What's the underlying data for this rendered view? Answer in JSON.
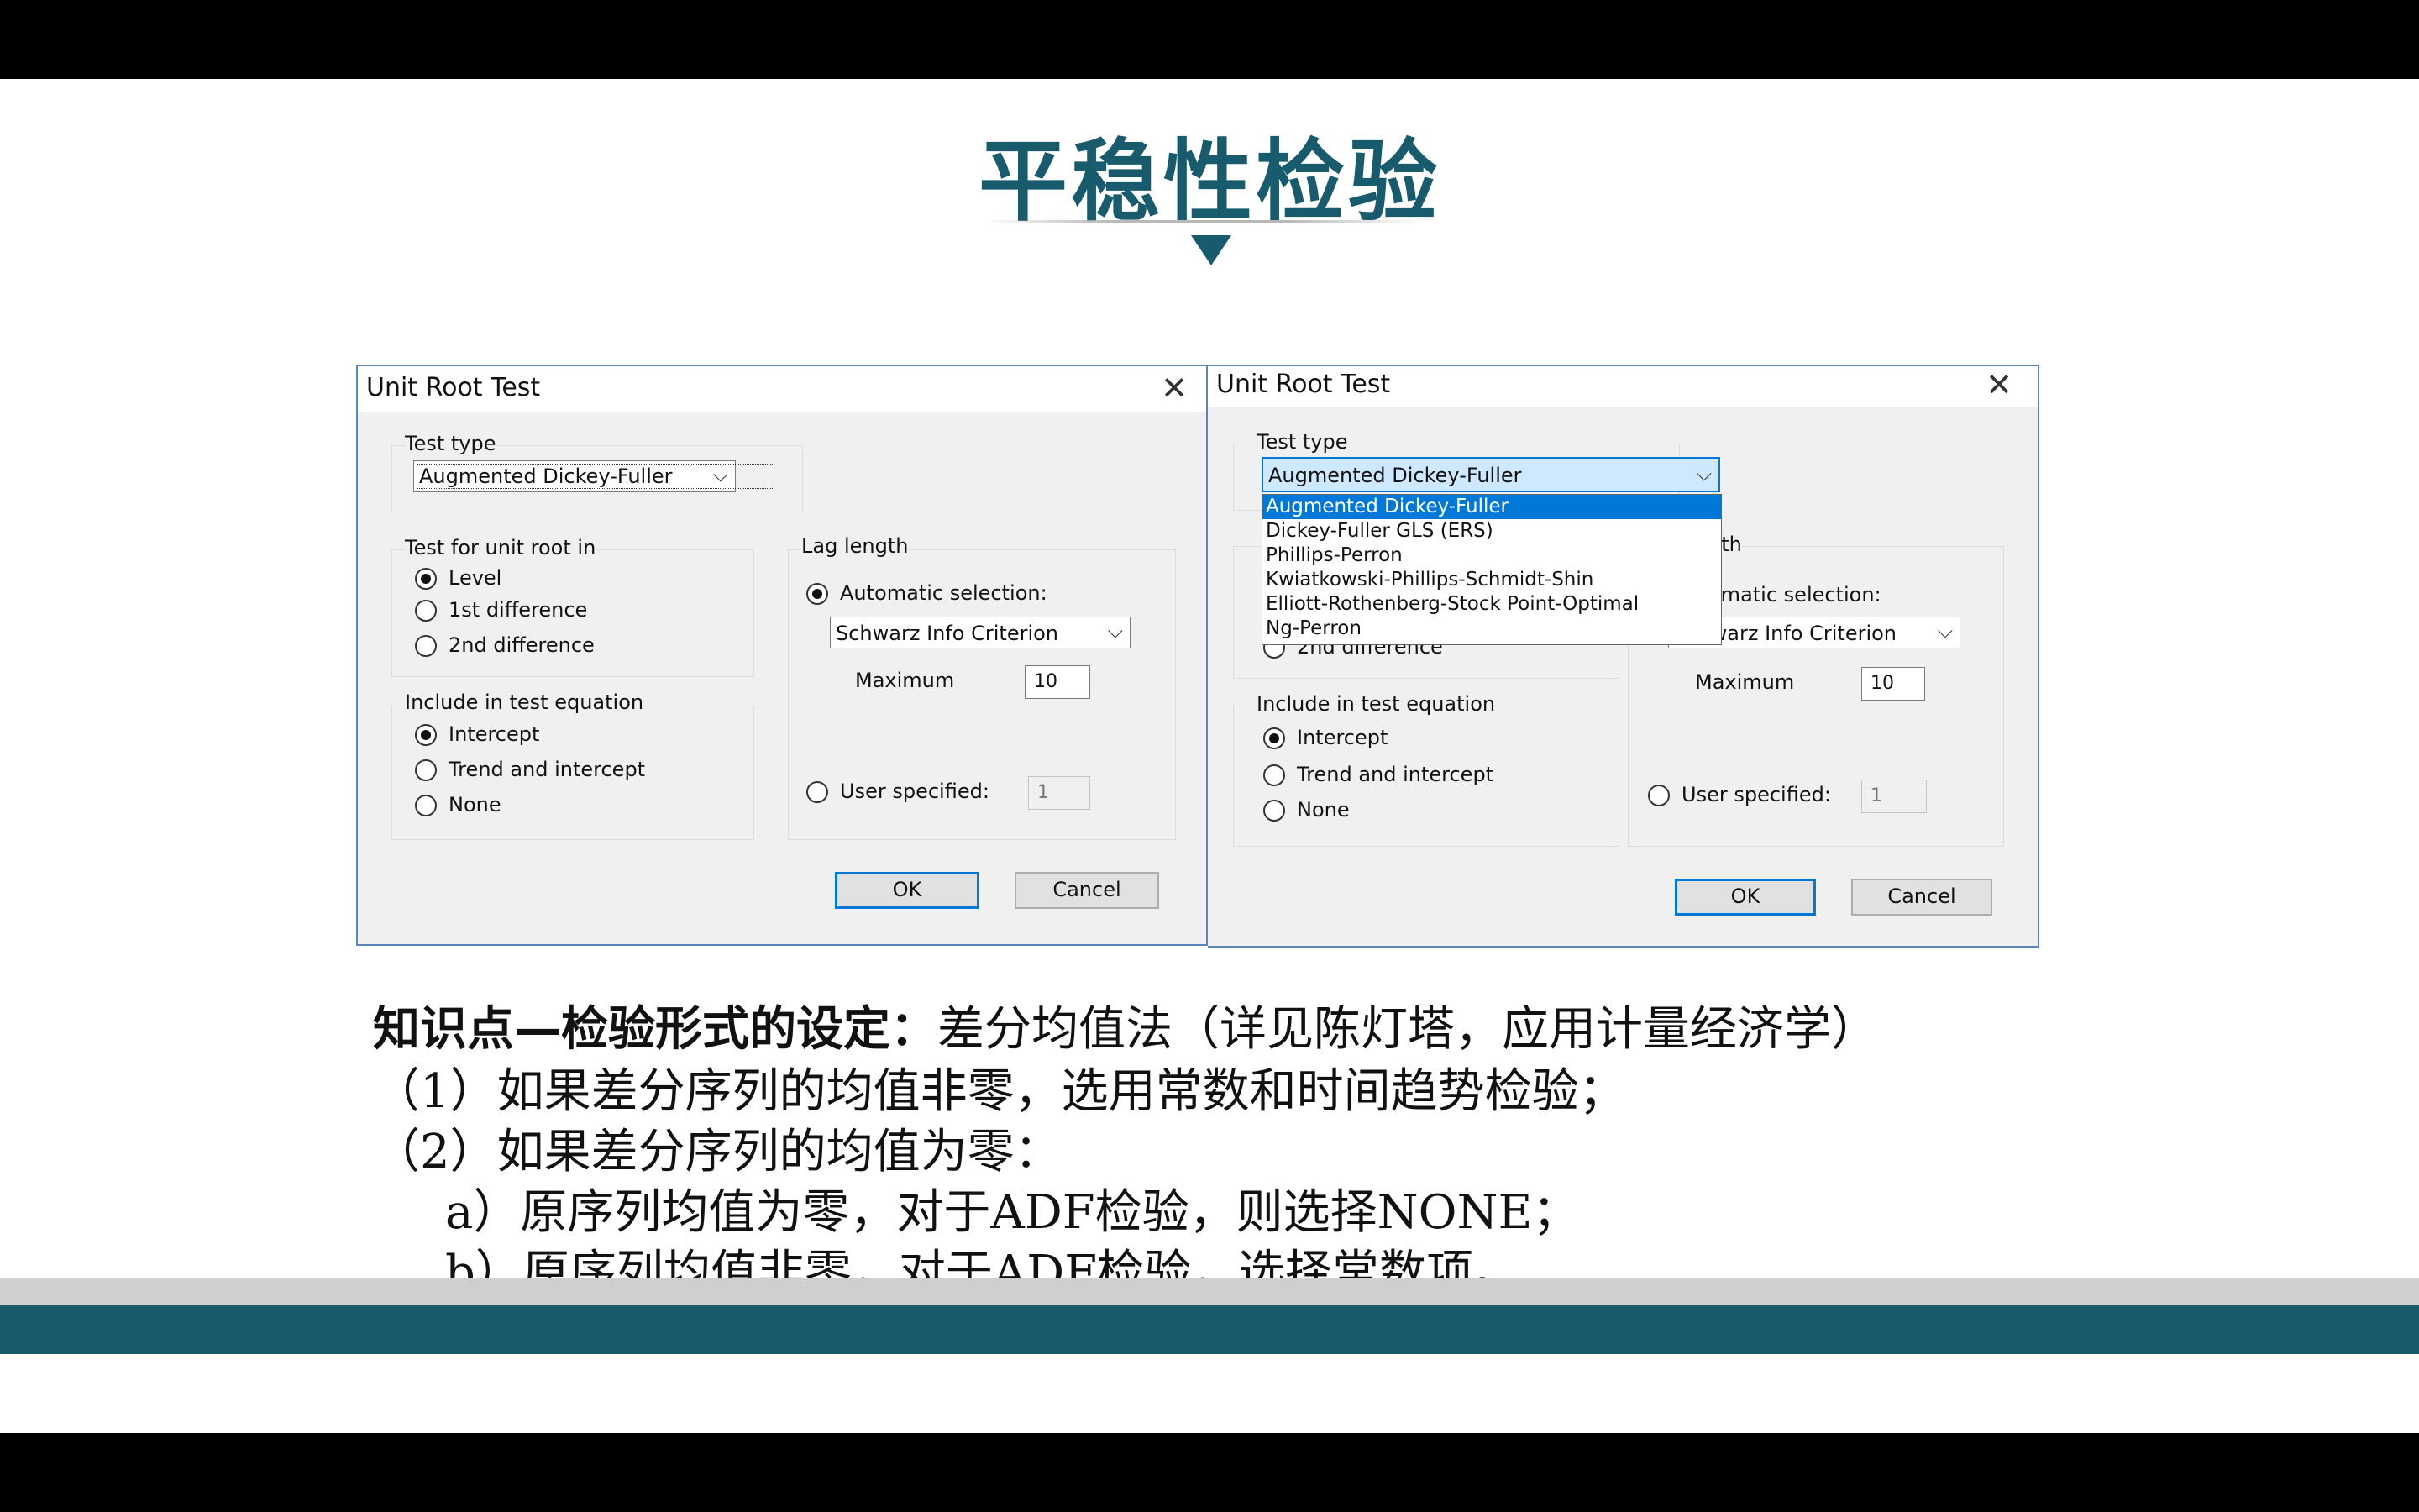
{
  "slide": {
    "title": "平稳性检验"
  },
  "dialog1": {
    "title": "Unit Root Test",
    "test_type_label": "Test type",
    "test_type_value": "Augmented Dickey-Fuller",
    "unit_root_label": "Test for unit root in",
    "unit_root_options": [
      "Level",
      "1st difference",
      "2nd difference"
    ],
    "unit_root_selected": "Level",
    "include_label": "Include in test equation",
    "include_options": [
      "Intercept",
      "Trend and intercept",
      "None"
    ],
    "include_selected": "Intercept",
    "lag_label": "Lag length",
    "auto_label": "Automatic selection:",
    "criterion_value": "Schwarz Info Criterion",
    "maximum_label": "Maximum",
    "maximum_value": "10",
    "user_label": "User specified:",
    "user_value": "1",
    "ok_label": "OK",
    "cancel_label": "Cancel"
  },
  "dialog2": {
    "title": "Unit Root Test",
    "test_type_label": "Test type",
    "test_type_value": "Augmented Dickey-Fuller",
    "dropdown_options": [
      "Augmented Dickey-Fuller",
      "Dickey-Fuller GLS (ERS)",
      "Phillips-Perron",
      "Kwiatkowski-Phillips-Schmidt-Shin",
      "Elliott-Rothenberg-Stock Point-Optimal",
      "Ng-Perron"
    ],
    "dropdown_highlighted": "Augmented Dickey-Fuller",
    "partial_option": "2nd difference",
    "lag_label_partial": "gth",
    "auto_label_partial": "omatic selection:",
    "criterion_value_partial": "Schwarz Info Criterion",
    "include_label": "Include in test equation",
    "include_options": [
      "Intercept",
      "Trend and intercept",
      "None"
    ],
    "include_selected": "Intercept",
    "maximum_label": "Maximum",
    "maximum_value": "10",
    "user_label": "User specified:",
    "user_value": "1",
    "ok_label": "OK",
    "cancel_label": "Cancel"
  },
  "notes": {
    "heading_bold": "知识点—检验形式的设定：",
    "heading_rest": "差分均值法（详见陈灯塔，应用计量经济学）",
    "line1": "（1）如果差分序列的均值非零，选用常数和时间趋势检验；",
    "line2": "（2）如果差分序列的均值为零：",
    "line3": "a）原序列均值为零，对于ADF检验，则选择NONE；",
    "line4": "b）原序列均值非零，对于ADF检验，选择常数项。"
  },
  "colors": {
    "accent": "#185b6c",
    "band_grey": "#cfcfcf",
    "selection": "#0078d7"
  }
}
